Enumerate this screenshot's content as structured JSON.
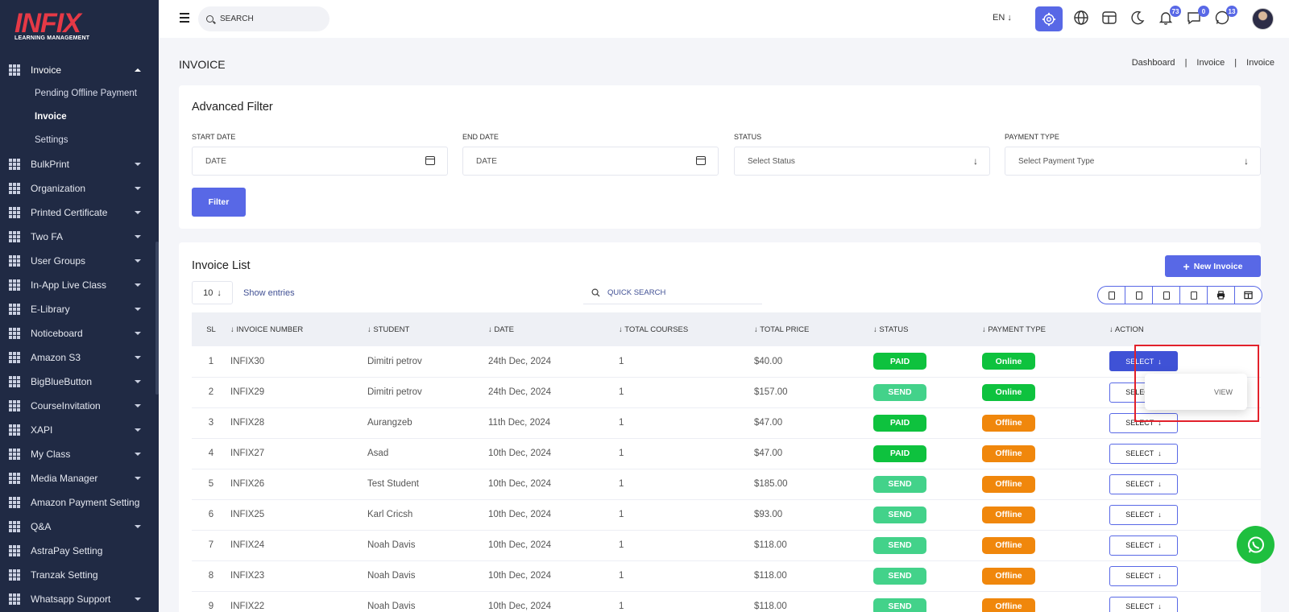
{
  "brand": {
    "name": "INFIX",
    "tagline": "LEARNING MANAGEMENT"
  },
  "sidebar": {
    "open_item": {
      "label": "Invoice",
      "children": [
        "Pending Offline Payment",
        "Invoice",
        "Settings"
      ],
      "current": "Invoice"
    },
    "items": [
      {
        "label": "BulkPrint",
        "caret": true
      },
      {
        "label": "Organization",
        "caret": true
      },
      {
        "label": "Printed Certificate",
        "caret": true
      },
      {
        "label": "Two FA",
        "caret": true
      },
      {
        "label": "User Groups",
        "caret": true
      },
      {
        "label": "In-App Live Class",
        "caret": true
      },
      {
        "label": "E-Library",
        "caret": true
      },
      {
        "label": "Noticeboard",
        "caret": true
      },
      {
        "label": "Amazon S3",
        "caret": true
      },
      {
        "label": "BigBlueButton",
        "caret": true
      },
      {
        "label": "CourseInvitation",
        "caret": true
      },
      {
        "label": "XAPI",
        "caret": true
      },
      {
        "label": "My Class",
        "caret": true
      },
      {
        "label": "Media Manager",
        "caret": true
      },
      {
        "label": "Amazon Payment Setting",
        "caret": false
      },
      {
        "label": "Q&A",
        "caret": true
      },
      {
        "label": "AstraPay Setting",
        "caret": false
      },
      {
        "label": "Tranzak Setting",
        "caret": false
      },
      {
        "label": "Whatsapp Support",
        "caret": true
      }
    ]
  },
  "topbar": {
    "search_placeholder": "SEARCH",
    "language": "EN",
    "notifications_count": "73",
    "messages_count": "0",
    "whatsapp_count": "13"
  },
  "page": {
    "title": "INVOICE",
    "breadcrumb": [
      "Dashboard",
      "Invoice",
      "Invoice"
    ]
  },
  "filter": {
    "title": "Advanced Filter",
    "start_date_label": "START DATE",
    "start_date_placeholder": "DATE",
    "end_date_label": "END DATE",
    "end_date_placeholder": "DATE",
    "status_label": "STATUS",
    "status_value": "Select Status",
    "payment_type_label": "PAYMENT TYPE",
    "payment_type_value": "Select Payment Type",
    "filter_button": "Filter"
  },
  "list": {
    "title": "Invoice List",
    "new_button": "New Invoice",
    "entries": "10",
    "show_entries": "Show entries",
    "quick_search_placeholder": "QUICK SEARCH",
    "columns": [
      "SL",
      "INVOICE NUMBER",
      "STUDENT",
      "DATE",
      "TOTAL COURSES",
      "TOTAL PRICE",
      "STATUS",
      "PAYMENT TYPE",
      "ACTION"
    ],
    "action_label": "SELECT",
    "dropdown_item": "VIEW",
    "rows": [
      {
        "sl": "1",
        "invoice": "INFIX30",
        "student": "Dimitri petrov",
        "date": "24th Dec, 2024",
        "courses": "1",
        "price": "$40.00",
        "status": "PAID",
        "payment": "Online"
      },
      {
        "sl": "2",
        "invoice": "INFIX29",
        "student": "Dimitri petrov",
        "date": "24th Dec, 2024",
        "courses": "1",
        "price": "$157.00",
        "status": "SEND",
        "payment": "Online"
      },
      {
        "sl": "3",
        "invoice": "INFIX28",
        "student": "Aurangzeb",
        "date": "11th Dec, 2024",
        "courses": "1",
        "price": "$47.00",
        "status": "PAID",
        "payment": "Offline"
      },
      {
        "sl": "4",
        "invoice": "INFIX27",
        "student": "Asad",
        "date": "10th Dec, 2024",
        "courses": "1",
        "price": "$47.00",
        "status": "PAID",
        "payment": "Offline"
      },
      {
        "sl": "5",
        "invoice": "INFIX26",
        "student": "Test Student",
        "date": "10th Dec, 2024",
        "courses": "1",
        "price": "$185.00",
        "status": "SEND",
        "payment": "Offline"
      },
      {
        "sl": "6",
        "invoice": "INFIX25",
        "student": "Karl Cricsh",
        "date": "10th Dec, 2024",
        "courses": "1",
        "price": "$93.00",
        "status": "SEND",
        "payment": "Offline"
      },
      {
        "sl": "7",
        "invoice": "INFIX24",
        "student": "Noah Davis",
        "date": "10th Dec, 2024",
        "courses": "1",
        "price": "$118.00",
        "status": "SEND",
        "payment": "Offline"
      },
      {
        "sl": "8",
        "invoice": "INFIX23",
        "student": "Noah Davis",
        "date": "10th Dec, 2024",
        "courses": "1",
        "price": "$118.00",
        "status": "SEND",
        "payment": "Offline"
      },
      {
        "sl": "9",
        "invoice": "INFIX22",
        "student": "Noah Davis",
        "date": "10th Dec, 2024",
        "courses": "1",
        "price": "$118.00",
        "status": "SEND",
        "payment": "Offline"
      }
    ]
  },
  "colors": {
    "accent": "#5868e6",
    "sidebar_bg": "#202a44",
    "paid": "#0ec23e",
    "send": "#43d28a",
    "offline": "#f0870c",
    "highlight": "#e2212b"
  }
}
